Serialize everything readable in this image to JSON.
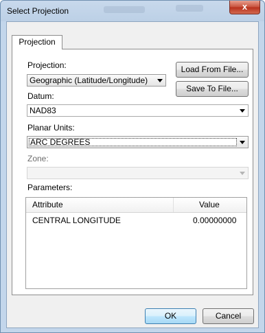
{
  "window": {
    "title": "Select Projection",
    "close_glyph": "x"
  },
  "tabs": [
    "Projection"
  ],
  "projection": {
    "label": "Projection:",
    "value": "Geographic (Latitude/Longitude)"
  },
  "buttons": {
    "load": "Load From File...",
    "save": "Save To File...",
    "ok": "OK",
    "cancel": "Cancel"
  },
  "datum": {
    "label": "Datum:",
    "value": "NAD83"
  },
  "planar_units": {
    "label": "Planar Units:",
    "value": "ARC DEGREES"
  },
  "zone": {
    "label": "Zone:",
    "value": ""
  },
  "parameters": {
    "label": "Parameters:",
    "columns": [
      "Attribute",
      "Value"
    ],
    "rows": [
      {
        "attribute": "CENTRAL LONGITUDE",
        "value": "0.00000000"
      }
    ]
  }
}
